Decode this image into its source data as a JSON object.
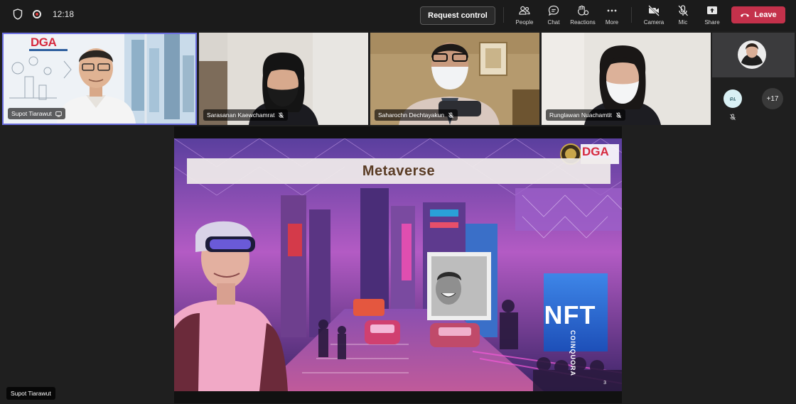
{
  "topbar": {
    "time": "12:18",
    "request_control_label": "Request control",
    "tools": [
      {
        "label": "People",
        "icon": "people-icon"
      },
      {
        "label": "Chat",
        "icon": "chat-icon"
      },
      {
        "label": "Reactions",
        "icon": "reactions-icon"
      },
      {
        "label": "More",
        "icon": "more-icon"
      },
      {
        "label": "Camera",
        "icon": "camera-off-icon"
      },
      {
        "label": "Mic",
        "icon": "mic-off-icon"
      },
      {
        "label": "Share",
        "icon": "share-icon"
      }
    ],
    "leave_label": "Leave"
  },
  "participants": [
    {
      "name": "Supot Tiarawut",
      "logo_text": "DGA",
      "status_icon": "screen-share-icon",
      "active": true
    },
    {
      "name": "Sarasanan Kaewchamrat",
      "status_icon": "mic-off-icon"
    },
    {
      "name": "Saharochn Dechtayakun",
      "status_icon": "mic-off-icon"
    },
    {
      "name": "Runglawan Nuachamtit",
      "status_icon": "mic-off-icon"
    }
  ],
  "side_pane": {
    "avatar_initials": "คเ",
    "overflow_count": "+17"
  },
  "slide": {
    "title": "Metaverse",
    "logo_text": "DGA",
    "nft_text": "NFT",
    "watermark_text": "COINQUORA",
    "page_number": "3"
  },
  "presenter_label": "Supot Tiarawut",
  "colors": {
    "leave": "#c4314b",
    "active_tile_border": "#6b6fe0",
    "background": "#1f1f1f"
  }
}
